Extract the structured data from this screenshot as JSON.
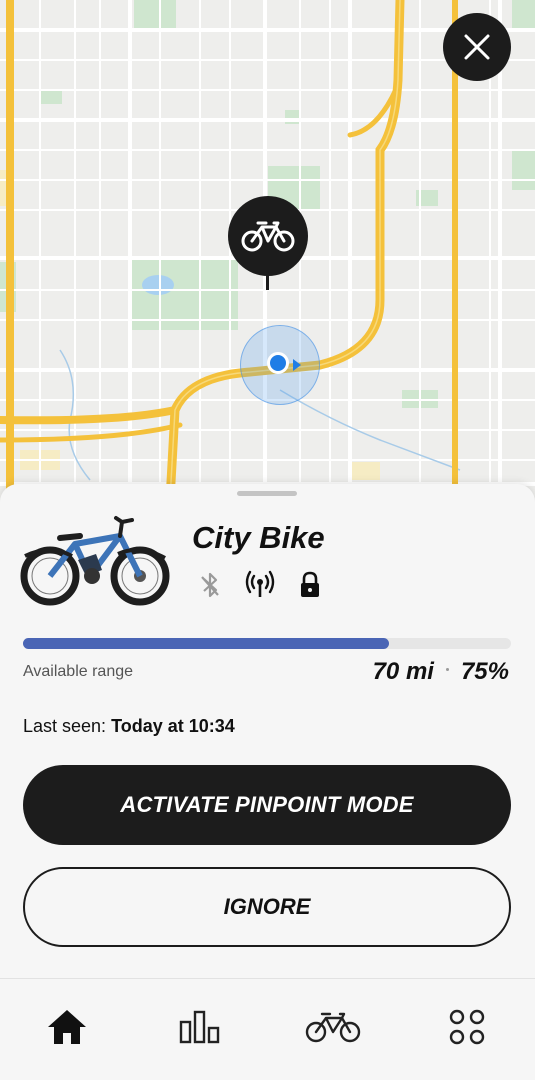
{
  "bike": {
    "name": "City Bike",
    "status_icons": [
      "bluetooth-off-icon",
      "cellular-signal-icon",
      "lock-icon"
    ]
  },
  "range": {
    "label": "Available range",
    "distance": "70 mi",
    "battery": "75%",
    "fill_fraction": 0.75
  },
  "last_seen": {
    "prefix": "Last seen: ",
    "value": "Today at 10:34"
  },
  "actions": {
    "primary_label": "ACTIVATE PINPOINT MODE",
    "secondary_label": "IGNORE"
  },
  "tabs": [
    "home-icon",
    "stats-icon",
    "bike-icon",
    "apps-grid-icon"
  ],
  "colors": {
    "accent": "#4a65b5",
    "dark": "#1c1c1c",
    "location": "#1f7de6",
    "highway": "#f4c13b"
  }
}
